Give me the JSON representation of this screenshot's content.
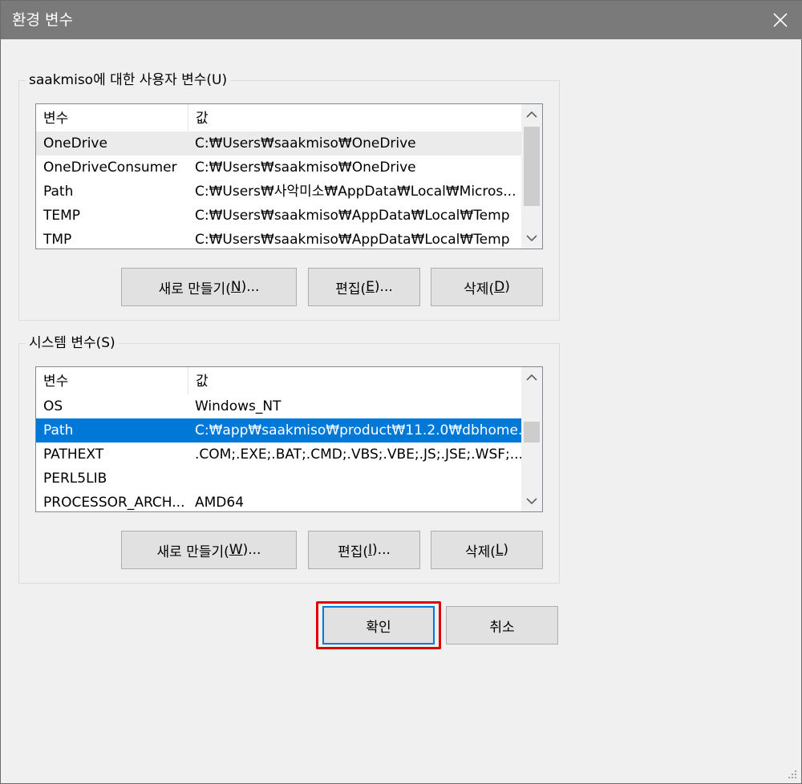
{
  "window": {
    "title": "환경 변수",
    "close_icon": "close-icon"
  },
  "user_vars": {
    "legend_prefix": "saakmiso에 대한 사용자 변수(",
    "legend_key": "U",
    "legend_suffix": ")",
    "columns": [
      "변수",
      "값"
    ],
    "rows": [
      {
        "name": "OneDrive",
        "value": "C:₩Users₩saakmiso₩OneDrive"
      },
      {
        "name": "OneDriveConsumer",
        "value": "C:₩Users₩saakmiso₩OneDrive"
      },
      {
        "name": "Path",
        "value": "C:₩Users₩사악미소₩AppData₩Local₩Micros..."
      },
      {
        "name": "TEMP",
        "value": "C:₩Users₩saakmiso₩AppData₩Local₩Temp"
      },
      {
        "name": "TMP",
        "value": "C:₩Users₩saakmiso₩AppData₩Local₩Temp"
      }
    ],
    "buttons": {
      "new_prefix": "새로 만들기(",
      "new_key": "N",
      "new_suffix": ")...",
      "edit_prefix": "편집(",
      "edit_key": "E",
      "edit_suffix": ")...",
      "delete_prefix": "삭제(",
      "delete_key": "D",
      "delete_suffix": ")"
    }
  },
  "system_vars": {
    "legend_prefix": "시스템 변수(",
    "legend_key": "S",
    "legend_suffix": ")",
    "columns": [
      "변수",
      "값"
    ],
    "rows": [
      {
        "name": "OS",
        "value": "Windows_NT"
      },
      {
        "name": "Path",
        "value": "C:₩app₩saakmiso₩product₩11.2.0₩dbhome..."
      },
      {
        "name": "PATHEXT",
        "value": ".COM;.EXE;.BAT;.CMD;.VBS;.VBE;.JS;.JSE;.WSF;...."
      },
      {
        "name": "PERL5LIB",
        "value": ""
      },
      {
        "name": "PROCESSOR_ARCH...",
        "value": "AMD64"
      }
    ],
    "buttons": {
      "new_prefix": "새로 만들기(",
      "new_key": "W",
      "new_suffix": ")...",
      "edit_prefix": "편집(",
      "edit_key": "I",
      "edit_suffix": ")...",
      "delete_prefix": "삭제(",
      "delete_key": "L",
      "delete_suffix": ")"
    }
  },
  "footer": {
    "ok_label": "확인",
    "cancel_label": "취소"
  },
  "colors": {
    "selection": "#0078d7",
    "highlight_box": "#e00000",
    "titlebar": "#7a7a7a"
  }
}
